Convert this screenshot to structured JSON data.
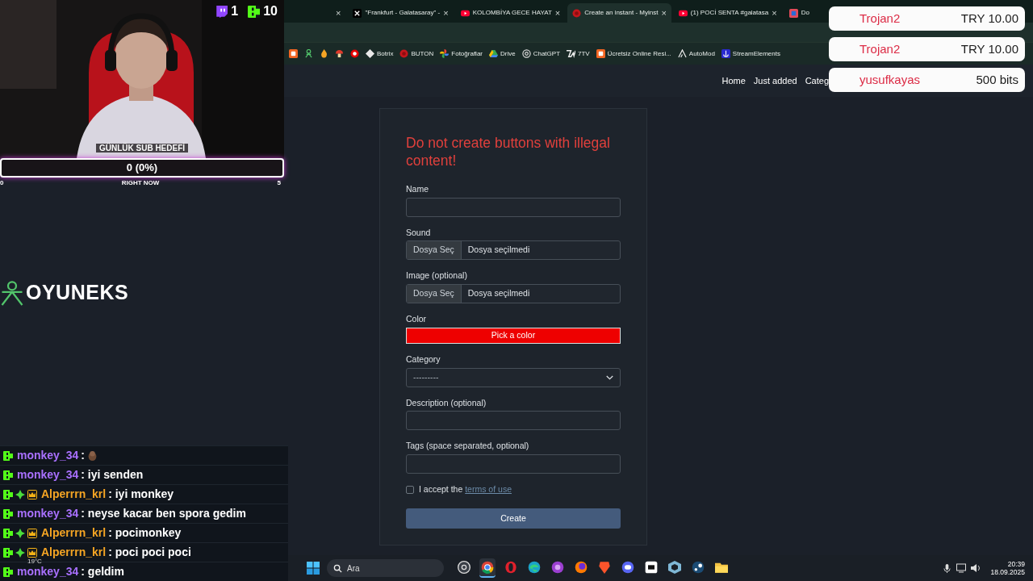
{
  "stream": {
    "counters": [
      {
        "kind": "bubble",
        "count": "1"
      },
      {
        "kind": "kick",
        "count": "10"
      }
    ],
    "goal": {
      "title": "GÜNLÜK SUB HEDEFİ",
      "reading": "0 (0%)",
      "level": 0,
      "start": "0",
      "caption": "RIGHT NOW",
      "end": "5"
    },
    "logo": "OYUNEKS",
    "chat": [
      {
        "user": "monkey_34",
        "color": "#a970ff",
        "kind": "regular",
        "message": ":",
        "emote": true
      },
      {
        "user": "monkey_34",
        "color": "#a970ff",
        "kind": "regular",
        "message": ": iyi senden"
      },
      {
        "user": "Alperrrn_krl",
        "color": "#f5a524",
        "kind": "subscriber",
        "message": ": iyi monkey"
      },
      {
        "user": "monkey_34",
        "color": "#a970ff",
        "kind": "regular",
        "message": ": neyse kacar ben spora gedim"
      },
      {
        "user": "Alperrrn_krl",
        "color": "#f5a524",
        "kind": "subscriber",
        "message": ": pocimonkey"
      },
      {
        "user": "Alperrrn_krl",
        "color": "#f5a524",
        "kind": "subscriber",
        "message": ": poci poci poci"
      },
      {
        "user": "monkey_34",
        "color": "#a970ff",
        "kind": "regular",
        "message": ": geldim"
      }
    ]
  },
  "alerts": [
    {
      "name": "Trojan2",
      "amount": "TRY 10.00"
    },
    {
      "name": "Trojan2",
      "amount": "TRY 10.00"
    },
    {
      "name": "yusufkayas",
      "amount": "500 bits"
    }
  ],
  "browser": {
    "tabs": [
      {
        "selected": false,
        "close": "×"
      },
      {
        "title": "\"Frankfurt - Galatasaray\" -",
        "selected": false,
        "close": "×"
      },
      {
        "title": "KOLOMBİYA GECE HAYAT",
        "selected": false,
        "close": "×"
      },
      {
        "title": "Create an instant - Myinst",
        "selected": true,
        "close": "×"
      },
      {
        "title": "(1) POCİ SENTA #galatasa",
        "selected": false,
        "close": "×"
      },
      {
        "title": "Do",
        "selected": false
      }
    ],
    "bookmarks": [
      {
        "kind": "icon"
      },
      {
        "kind": "icon"
      },
      {
        "kind": "icon"
      },
      {
        "kind": "icon"
      },
      {
        "kind": "icon"
      },
      {
        "kind": "link",
        "label": "Botrix"
      },
      {
        "kind": "link",
        "label": "BUTON"
      },
      {
        "kind": "link",
        "label": "Fotoğraflar"
      },
      {
        "kind": "link",
        "label": "Drive"
      },
      {
        "kind": "link",
        "label": "ChatGPT"
      },
      {
        "kind": "link",
        "label": "7TV"
      },
      {
        "kind": "link",
        "label": "Ücretsiz Online Resi..."
      },
      {
        "kind": "link",
        "label": "AutoMod"
      },
      {
        "kind": "link",
        "label": "StreamElements"
      }
    ]
  },
  "page": {
    "nav": [
      "Home",
      "Just added",
      "Categ"
    ],
    "title": "Do not create buttons with illegal content!",
    "fields": [
      {
        "kind": "text",
        "label": "Name"
      },
      {
        "kind": "file",
        "label": "Sound",
        "button": "Dosya Seç",
        "value": "Dosya seçilmedi"
      },
      {
        "kind": "file",
        "label": "Image (optional)",
        "button": "Dosya Seç",
        "value": "Dosya seçilmedi"
      },
      {
        "kind": "color",
        "label": "Color",
        "button": "Pick a color",
        "color": "#ee0000"
      },
      {
        "kind": "select",
        "label": "Category",
        "value": "---------"
      },
      {
        "kind": "text",
        "label": "Description (optional)"
      },
      {
        "kind": "text",
        "label": "Tags (space separated, optional)"
      }
    ],
    "accept": {
      "checked": false,
      "text": "I accept the",
      "link": "terms of use"
    },
    "submit": "Create"
  },
  "taskbar": {
    "search": {
      "placeholder": "Ara"
    },
    "weather": "19°C",
    "apps": [
      {
        "kind": "aperture",
        "selected": false
      },
      {
        "kind": "wheel",
        "selected": true
      },
      {
        "kind": "ring",
        "selected": false
      },
      {
        "kind": "swirl",
        "selected": false
      },
      {
        "kind": "orb",
        "selected": false
      },
      {
        "kind": "flame",
        "selected": false
      },
      {
        "kind": "shield",
        "selected": false
      },
      {
        "kind": "controller",
        "selected": false
      },
      {
        "kind": "tile",
        "selected": false
      },
      {
        "kind": "cube",
        "selected": false
      },
      {
        "kind": "steam",
        "selected": false
      },
      {
        "kind": "folder",
        "selected": false
      }
    ],
    "time": "20:39",
    "date": "18.09.2025"
  }
}
